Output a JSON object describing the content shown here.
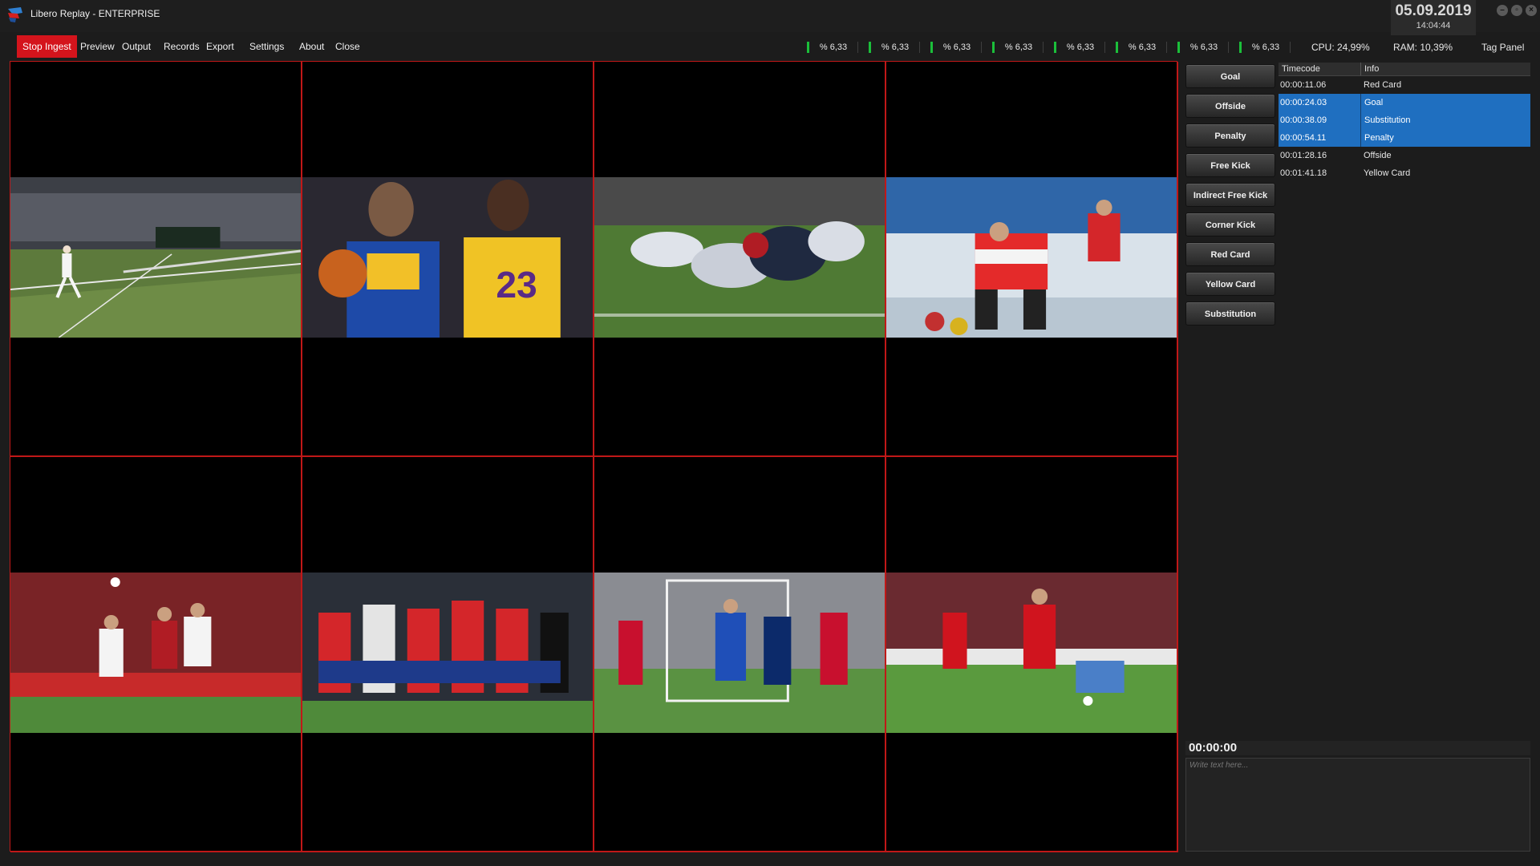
{
  "titlebar": {
    "title": "Libero Replay - ENTERPRISE",
    "date": "05.09.2019",
    "time": "14:04:44"
  },
  "menu": {
    "items": [
      "Stop Ingest",
      "Preview",
      "Output",
      "Records",
      "Export",
      "Settings",
      "About",
      "Close"
    ],
    "active": "Stop Ingest"
  },
  "meters": [
    "% 6,33",
    "% 6,33",
    "% 6,33",
    "% 6,33",
    "% 6,33",
    "% 6,33",
    "% 6,33",
    "% 6,33"
  ],
  "status": {
    "cpu": "CPU: 24,99%",
    "ram": "RAM: 10,39%",
    "tag_panel": "Tag Panel"
  },
  "channels": [
    {
      "icon": "tennis-feed-thumbnail"
    },
    {
      "icon": "basketball-feed-thumbnail"
    },
    {
      "icon": "american-football-feed-thumbnail"
    },
    {
      "icon": "curling-feed-thumbnail"
    },
    {
      "icon": "soccer-feed-thumbnail"
    },
    {
      "icon": "soccer-feed-thumbnail"
    },
    {
      "icon": "soccer-feed-thumbnail"
    },
    {
      "icon": "soccer-feed-thumbnail"
    }
  ],
  "tag_buttons": [
    "Goal",
    "Offside",
    "Penalty",
    "Free Kick",
    "Indirect Free Kick",
    "Corner Kick",
    "Red Card",
    "Yellow Card",
    "Substitution"
  ],
  "tag_list": {
    "headers": {
      "timecode": "Timecode",
      "info": "Info"
    },
    "rows": [
      {
        "timecode": "00:00:11.06",
        "info": "Red Card",
        "selected": false
      },
      {
        "timecode": "00:00:24.03",
        "info": "Goal",
        "selected": true
      },
      {
        "timecode": "00:00:38.09",
        "info": "Substitution",
        "selected": true
      },
      {
        "timecode": "00:00:54.11",
        "info": "Penalty",
        "selected": true
      },
      {
        "timecode": "00:01:28.16",
        "info": "Offside",
        "selected": false
      },
      {
        "timecode": "00:01:41.18",
        "info": "Yellow Card",
        "selected": false
      }
    ]
  },
  "note": {
    "timecode": "00:00:00",
    "placeholder": "Write text here..."
  },
  "colors": {
    "accent_red": "#d4141c",
    "selection_blue": "#1f6fc0",
    "meter_green": "#1bbf3a",
    "background": "#1c1c1c"
  }
}
